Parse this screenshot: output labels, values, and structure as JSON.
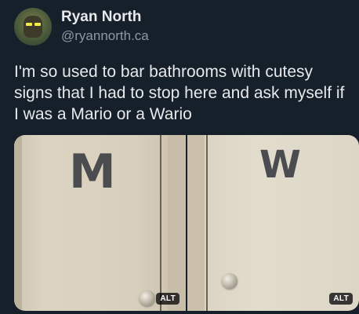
{
  "author": {
    "display_name": "Ryan North",
    "handle": "@ryannorth.ca"
  },
  "post": {
    "text": "I'm so used to bar bathrooms with cutesy signs that I had to stop here and ask myself if I was a Mario or a Wario"
  },
  "media": [
    {
      "door_letter": "M",
      "alt_label": "ALT"
    },
    {
      "door_letter": "W",
      "alt_label": "ALT"
    }
  ],
  "colors": {
    "background": "#15202b",
    "text_primary": "#e7e9ea",
    "text_secondary": "#8b98a5",
    "letter_sign": "#4a4c50"
  }
}
